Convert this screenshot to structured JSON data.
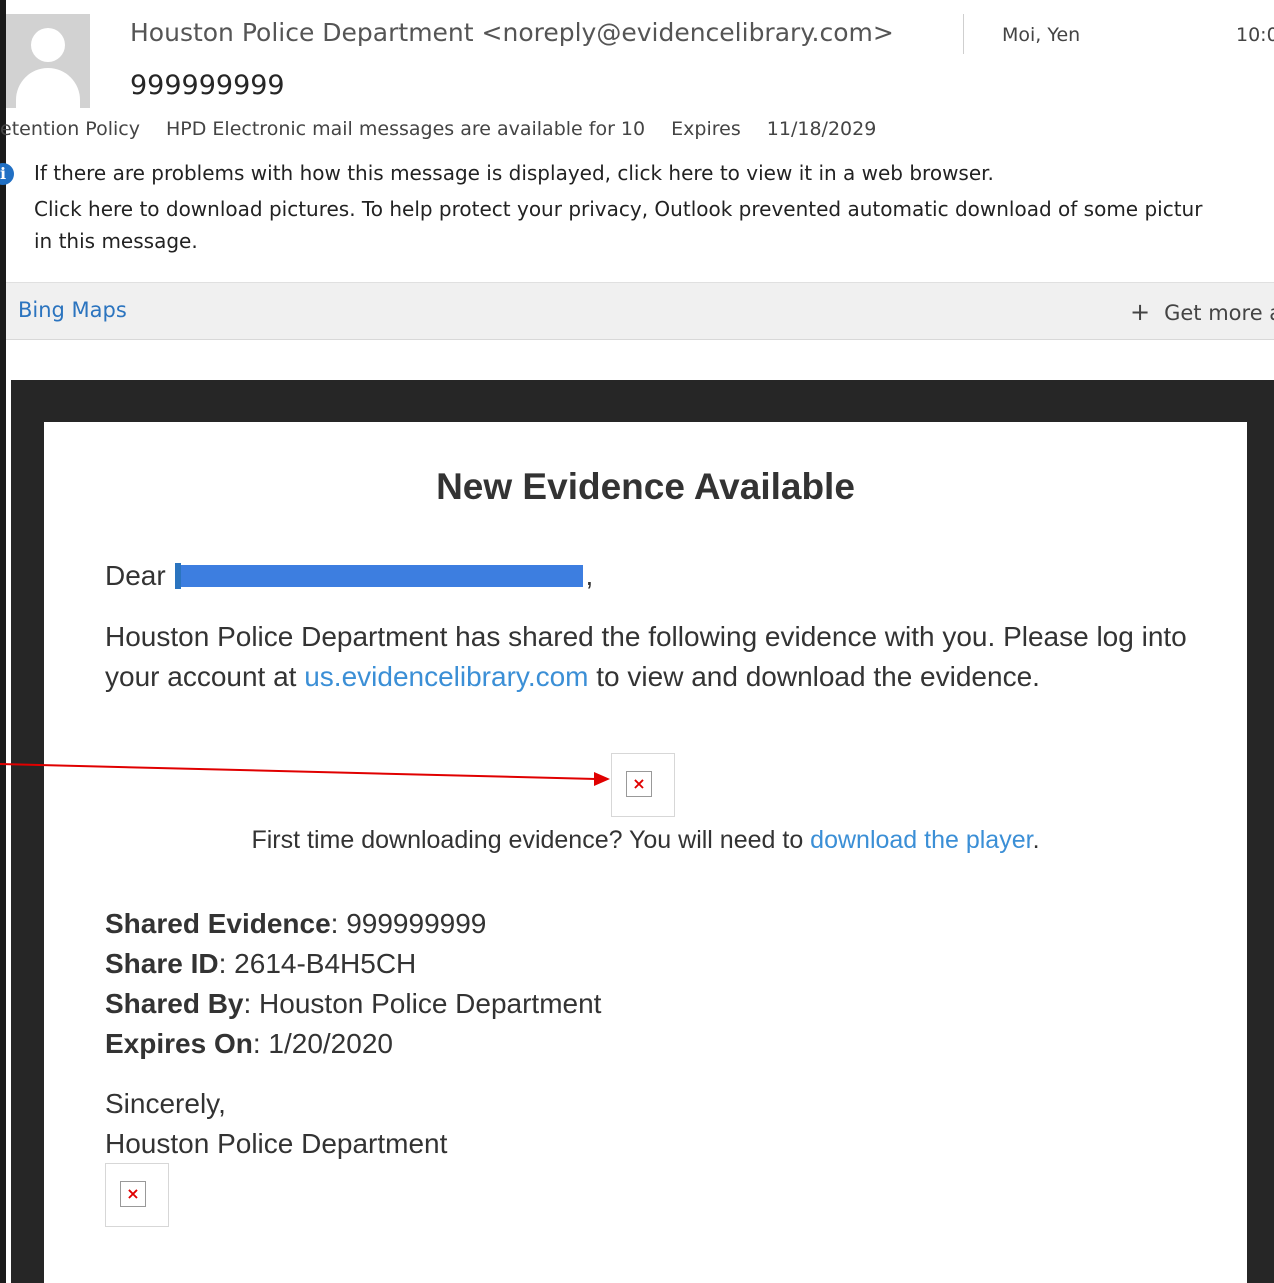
{
  "header": {
    "from": "Houston Police Department <noreply@evidencelibrary.com>",
    "to": "Moi, Yen",
    "time": "10:0",
    "subject": "999999999",
    "retention_label": "etention Policy",
    "retention_value": "HPD Electronic mail messages are available for 10",
    "expires_label": "Expires",
    "expires_value": "11/18/2029"
  },
  "infobar": {
    "line1": "If there are problems with how this message is displayed, click here to view it in a web browser.",
    "line2": "Click here to download pictures. To help protect your privacy, Outlook prevented automatic download of some pictur",
    "line3": "in this message."
  },
  "addins": {
    "bing_maps": "Bing Maps",
    "get_more": "Get more a"
  },
  "email": {
    "title": "New Evidence Available",
    "dear": "Dear",
    "dear_comma": ",",
    "para_part1": "Houston Police Department has shared the following evidence with you. Please log into your account at",
    "para_link": "us.evidencelibrary.com",
    "para_part2": "to view and download the evidence.",
    "first_time_text": "First time downloading evidence? You will need to",
    "first_time_link": "download the player",
    "first_time_end": ".",
    "details": [
      {
        "label": "Shared Evidence",
        "value": ": 999999999"
      },
      {
        "label": "Share ID",
        "value": ": 2614-B4H5CH"
      },
      {
        "label": "Shared By",
        "value": ": Houston Police Department"
      },
      {
        "label": "Expires On",
        "value": ": 1/20/2020"
      }
    ],
    "sincerely": "Sincerely,",
    "signature": "Houston Police Department",
    "broken_image_glyph": "×"
  },
  "colors": {
    "link": "#3b8fd6",
    "redaction": "#3d7ee0",
    "annotation_arrow": "#e00000",
    "frame": "#262626"
  }
}
